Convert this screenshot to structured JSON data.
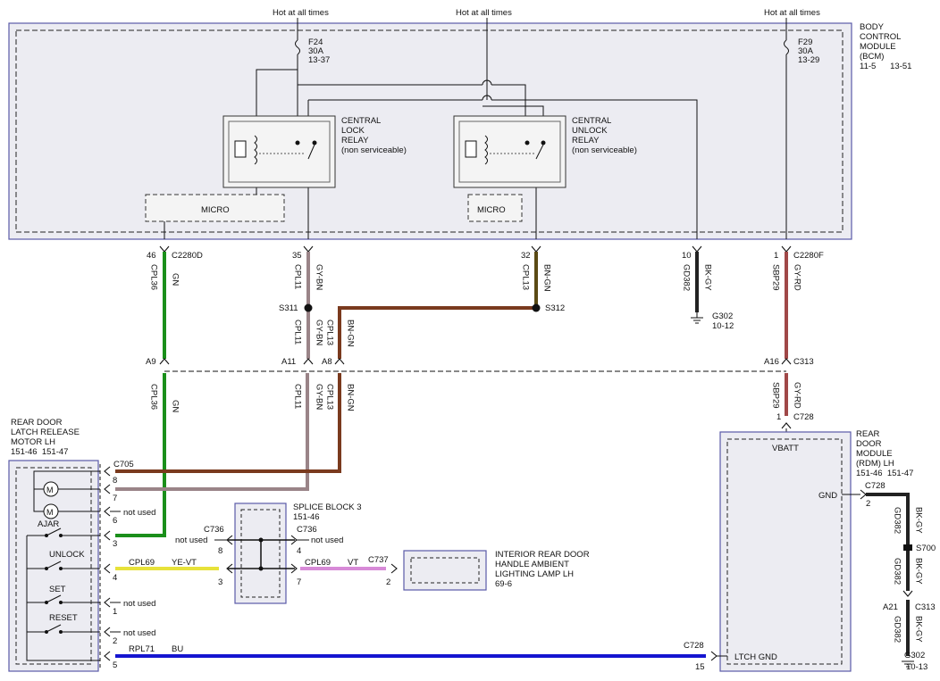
{
  "colors": {
    "green": "#1a8f1a",
    "brown": "#7a3a1e",
    "gray_brown": "#9a8488",
    "dark_brown_green": "#5a4a14",
    "gray_red": "#a04848",
    "black_gray": "#222222",
    "yellow_violet": "#e7e23a",
    "violet": "#d78ad7",
    "blue": "#1515d0",
    "module_border": "#5a5aa8",
    "module_fill": "#ececf2"
  },
  "top": {
    "hot1": "Hot at all times",
    "hot2": "Hot at all times",
    "hot3": "Hot at all times",
    "f24": [
      "F24",
      "30A",
      "13-37"
    ],
    "f29": [
      "F29",
      "30A",
      "13-29"
    ]
  },
  "bcm": {
    "label": [
      "BODY",
      "CONTROL",
      "MODULE",
      "(BCM)"
    ],
    "refs": "11-5      13-51",
    "lock_relay": [
      "CENTRAL",
      "LOCK",
      "RELAY",
      "(non serviceable)"
    ],
    "unlock_relay": [
      "CENTRAL",
      "UNLOCK",
      "RELAY",
      "(non serviceable)"
    ],
    "micro1": "MICRO",
    "micro2": "MICRO"
  },
  "pins": {
    "p46": "46",
    "c2280d": "C2280D",
    "p35": "35",
    "p32": "32",
    "p10": "10",
    "p1": "1",
    "c2280f": "C2280F"
  },
  "wires": {
    "cpl36": "CPL36",
    "gn": "GN",
    "cpl11": "CPL11",
    "gybn": "GY-BN",
    "cpl13": "CPL13",
    "bngn": "BN-GN",
    "gd382": "GD382",
    "bkgy": "BK-GY",
    "sbp29": "SBP29",
    "gyrd": "GY-RD",
    "cpl69": "CPL69",
    "yevt": "YE-VT",
    "vt": "VT",
    "rpl71": "RPL71",
    "bu": "BU"
  },
  "splices": {
    "s311": "S311",
    "s312": "S312",
    "s700": "S700"
  },
  "grounds": {
    "g302a": [
      "G302",
      "10-12"
    ],
    "g302b": [
      "G302",
      "10-13"
    ]
  },
  "inline": {
    "a9": "A9",
    "a11": "A11",
    "a8": "A8",
    "a16": "A16",
    "c313": "C313",
    "c728": "C728",
    "one": "1"
  },
  "motor": {
    "label": [
      "REAR DOOR",
      "LATCH RELEASE",
      "MOTOR LH",
      "151-46  151-47"
    ],
    "c705": "C705",
    "ajar": "AJAR",
    "unlock": "UNLOCK",
    "set": "SET",
    "reset": "RESET",
    "pins": [
      "8",
      "7",
      "6",
      "3",
      "4",
      "1",
      "2",
      "5"
    ],
    "not_used": "not used"
  },
  "splice_block": {
    "label": [
      "SPLICE BLOCK 3",
      "151-46"
    ],
    "c736": "C736",
    "pins": [
      "8",
      "4",
      "3",
      "7"
    ],
    "not_used": "not used"
  },
  "lamp": {
    "label": [
      "INTERIOR REAR DOOR",
      "HANDLE AMBIENT",
      "LIGHTING LAMP LH",
      "69-6"
    ],
    "c737": "C737",
    "pin": "2"
  },
  "rdm": {
    "label": [
      "REAR",
      "DOOR",
      "MODULE",
      "(RDM) LH",
      "151-46  151-47"
    ],
    "vbatt": "VBATT",
    "gnd": "GND",
    "ltch_gnd": "LTCH GND",
    "c728": "C728",
    "pin2": "2",
    "pin15": "15",
    "a21": "A21",
    "c313": "C313"
  }
}
